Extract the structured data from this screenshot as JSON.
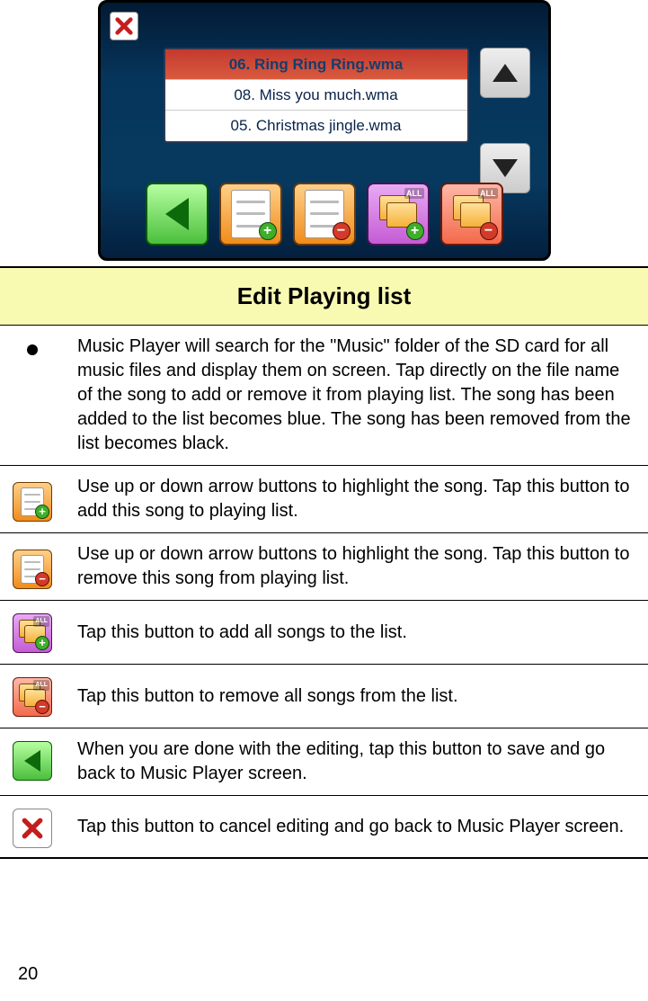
{
  "screenshot": {
    "songs": [
      {
        "label": "06. Ring Ring Ring.wma",
        "selected": true
      },
      {
        "label": "08. Miss you much.wma",
        "selected": false
      },
      {
        "label": "05. Christmas jingle.wma",
        "selected": false
      }
    ],
    "all_label": "ALL"
  },
  "table": {
    "title": "Edit Playing list",
    "rows": [
      {
        "icon": "bullet",
        "text": "Music Player will search for the \"Music\" folder of the SD card for all music files and display them on screen. Tap directly on the file name of the song to add or remove it from playing list. The song has been added to the list becomes blue. The song has been removed from the list becomes black."
      },
      {
        "icon": "add-one",
        "text": "Use up or down arrow buttons to highlight the song. Tap this button to add this song to playing list."
      },
      {
        "icon": "remove-one",
        "text": "Use up or down arrow buttons to highlight the song. Tap this button to remove this song from playing list."
      },
      {
        "icon": "add-all",
        "text": "Tap this button to add all songs to the list."
      },
      {
        "icon": "remove-all",
        "text": "Tap this button to remove all songs from the list."
      },
      {
        "icon": "back",
        "text": "When you are done with the editing, tap this button to save and go back to Music Player screen."
      },
      {
        "icon": "cancel",
        "text": "Tap this button to cancel editing and go back to Music Player screen."
      }
    ]
  },
  "page_number": "20"
}
